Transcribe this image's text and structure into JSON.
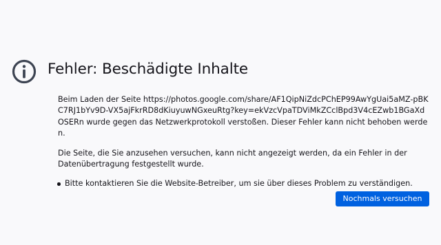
{
  "error": {
    "icon": "info-circle-icon",
    "title": "Fehler: Beschädigte Inhalte",
    "description": "Beim Laden der Seite https://photos.google.com/share/AF1QipNiZdcPChEP99AwYgUai5aMZ-pBKC7RJ1bYv9D-VX5ajFkrRD8dKiuyuwNGxeuRtg?key=ekVzcVpaTDViMkZCclBpd3V4cEZwb1BGaXdOSERn wurde gegen das Netzwerkprotokoll verstoßen. Dieser Fehler kann nicht behoben werden.",
    "explanation": "Die Seite, die Sie anzusehen versuchen, kann nicht angezeigt werden, da ein Fehler in der Datenübertragung festgestellt wurde.",
    "hints": [
      "Bitte kontaktieren Sie die Website-Betreiber, um sie über dieses Problem zu verständigen."
    ],
    "retry_label": "Nochmals versuchen"
  },
  "colors": {
    "background": "#f9f9fb",
    "text": "#15141a",
    "icon": "#3d4452",
    "button": "#0061e0",
    "button_text": "#ffffff"
  }
}
